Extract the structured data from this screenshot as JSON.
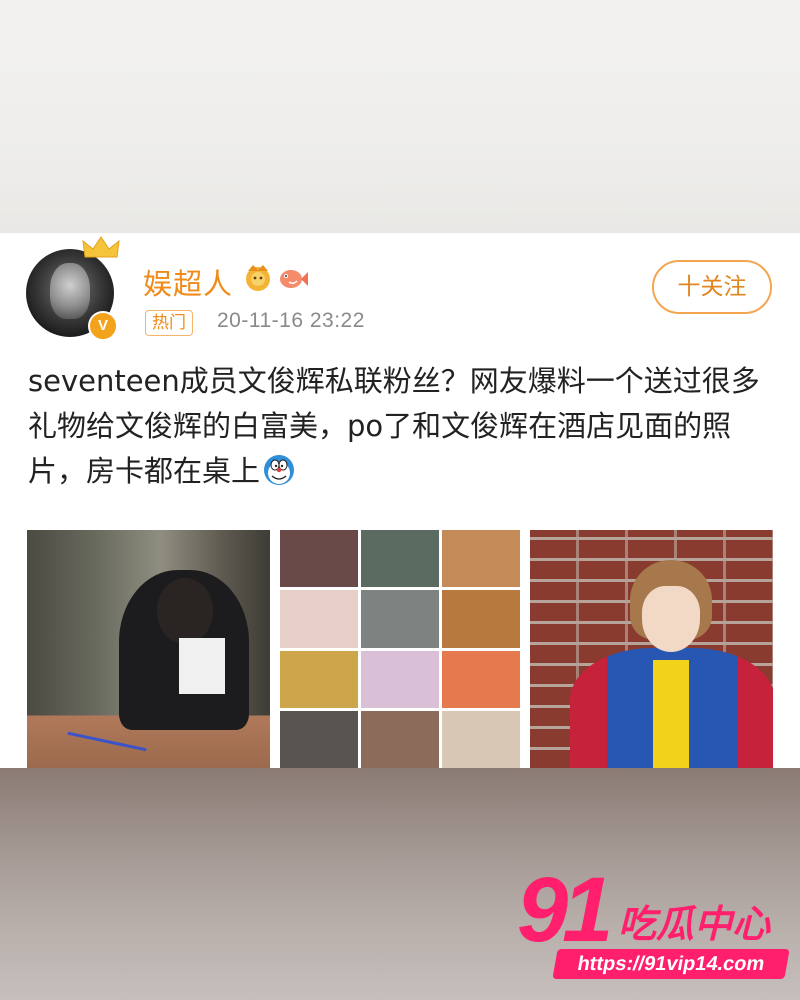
{
  "post": {
    "username": "娱超人",
    "hot_label": "热门",
    "timestamp": "20-11-16 23:22",
    "follow_label": "十关注",
    "text": "seventeen成员文俊辉私联粉丝？网友爆料一个送过很多礼物给文俊辉的白富美，po了和文俊辉在酒店见面的照片，房卡都在桌上",
    "verified_badge": "V",
    "icons": [
      "crown-icon",
      "lion-badge-icon",
      "fish-badge-icon",
      "doraemon-emoji-icon",
      "verified-badge-icon"
    ],
    "accent_color": "#f08b1a",
    "images": [
      {
        "name": "photo-woman-at-table"
      },
      {
        "name": "photo-gifts-collage"
      },
      {
        "name": "photo-man-red-blue-jacket"
      }
    ]
  },
  "watermark": {
    "number": "91",
    "site_name": "吃瓜中心",
    "url": "https://91vip14.com",
    "color": "#ff1f6d"
  }
}
